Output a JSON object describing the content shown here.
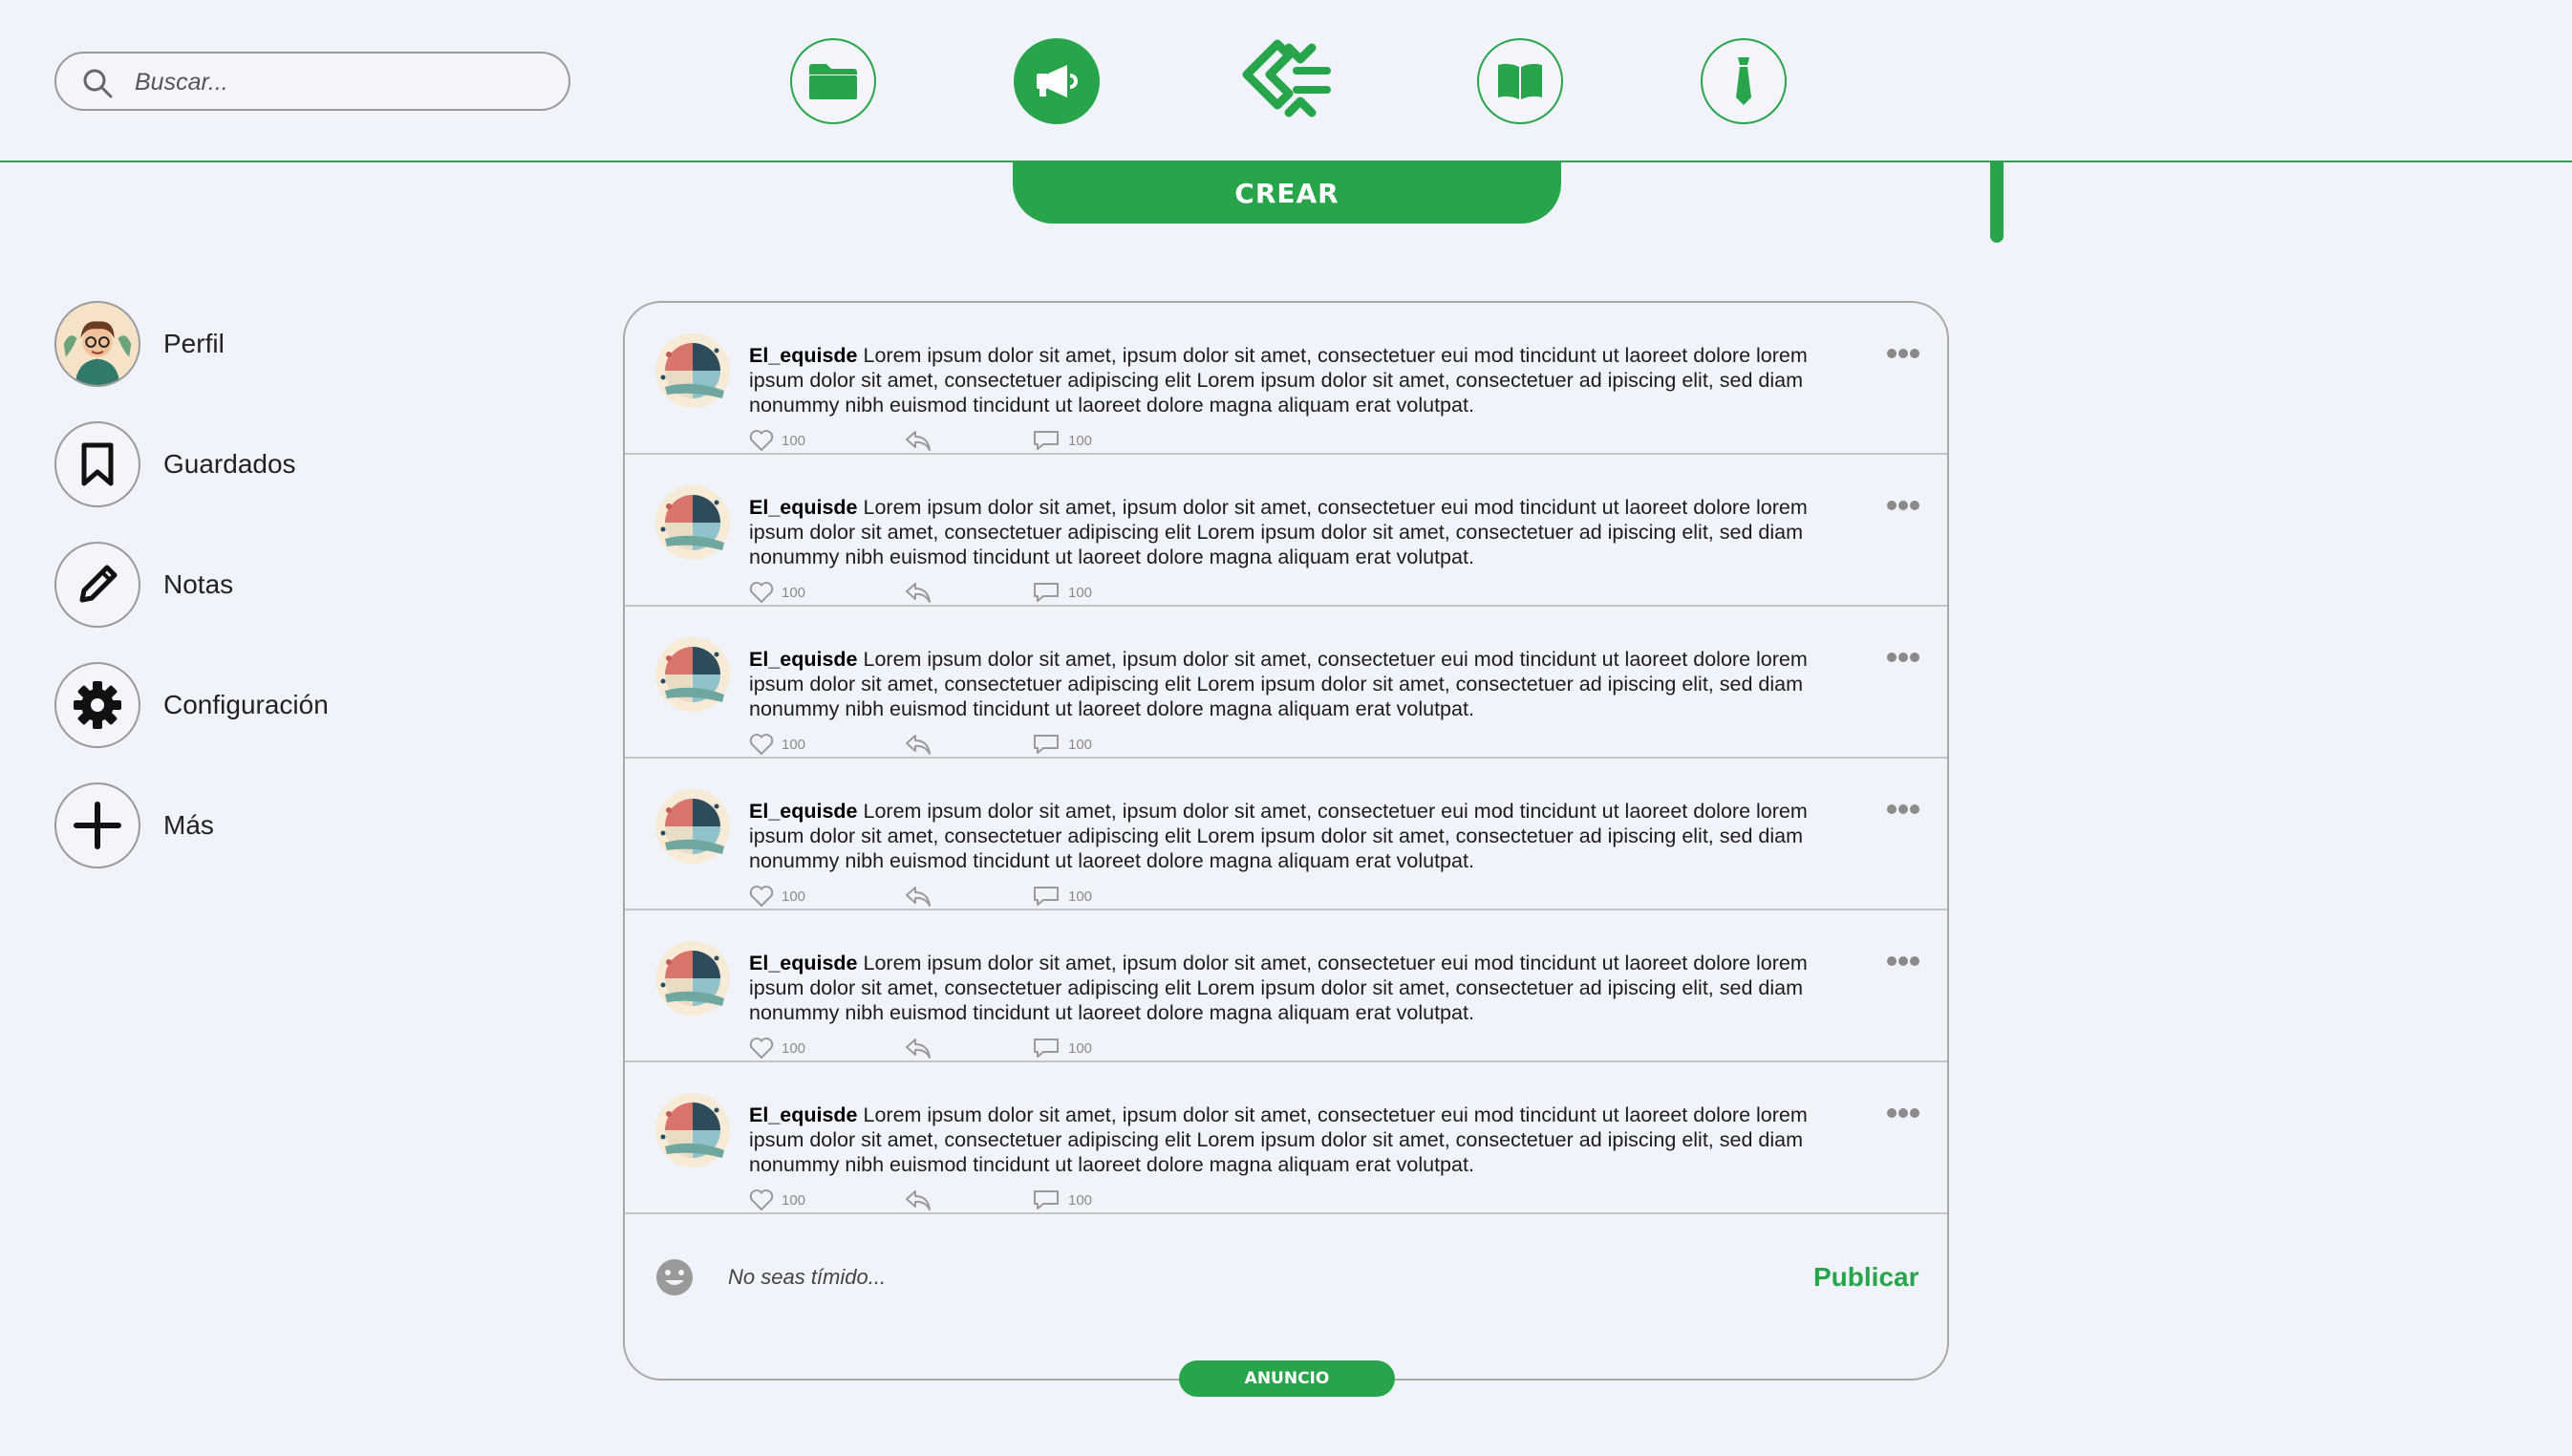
{
  "colors": {
    "accent": "#28a54b",
    "background": "#f0f3f9",
    "border": "#9a9a9a"
  },
  "header": {
    "search": {
      "placeholder": "Buscar..."
    },
    "nav": [
      {
        "name": "folder-icon"
      },
      {
        "name": "megaphone-icon",
        "active": true
      },
      {
        "name": "app-logo"
      },
      {
        "name": "book-icon"
      },
      {
        "name": "tie-icon"
      }
    ],
    "create_label": "CREAR"
  },
  "sidebar": {
    "items": [
      {
        "label": "Perfil",
        "icon": "profile-avatar"
      },
      {
        "label": "Guardados",
        "icon": "bookmark-icon"
      },
      {
        "label": "Notas",
        "icon": "pencil-icon"
      },
      {
        "label": "Configuración",
        "icon": "gear-icon"
      },
      {
        "label": "Más",
        "icon": "plus-icon"
      }
    ]
  },
  "feed": {
    "posts": [
      {
        "user": "El_equisde",
        "text": " Lorem ipsum dolor sit amet, ipsum dolor sit amet, consectetuer eui mod tincidunt ut laoreet  dolore lorem ipsum dolor sit amet, consectetuer adipiscing elit Lorem ipsum dolor sit amet, consectetuer ad ipiscing elit, sed diam nonummy nibh euismod tincidunt ut laoreet dolore magna aliquam erat volutpat.",
        "likes": "100",
        "comments": "100"
      },
      {
        "user": "El_equisde",
        "text": " Lorem ipsum dolor sit amet, ipsum dolor sit amet, consectetuer eui mod tincidunt ut laoreet  dolore lorem ipsum dolor sit amet, consectetuer adipiscing elit Lorem ipsum dolor sit amet, consectetuer ad ipiscing elit, sed diam nonummy nibh euismod tincidunt ut laoreet dolore magna aliquam erat volutpat.",
        "likes": "100",
        "comments": "100"
      },
      {
        "user": "El_equisde",
        "text": " Lorem ipsum dolor sit amet, ipsum dolor sit amet, consectetuer eui mod tincidunt ut laoreet  dolore lorem ipsum dolor sit amet, consectetuer adipiscing elit Lorem ipsum dolor sit amet, consectetuer ad ipiscing elit, sed diam nonummy nibh euismod tincidunt ut laoreet dolore magna aliquam erat volutpat.",
        "likes": "100",
        "comments": "100"
      },
      {
        "user": "El_equisde",
        "text": " Lorem ipsum dolor sit amet, ipsum dolor sit amet, consectetuer eui mod tincidunt ut laoreet  dolore lorem ipsum dolor sit amet, consectetuer adipiscing elit Lorem ipsum dolor sit amet, consectetuer ad ipiscing elit, sed diam nonummy nibh euismod tincidunt ut laoreet dolore magna aliquam erat volutpat.",
        "likes": "100",
        "comments": "100"
      },
      {
        "user": "El_equisde",
        "text": " Lorem ipsum dolor sit amet, ipsum dolor sit amet, consectetuer eui mod tincidunt ut laoreet  dolore lorem ipsum dolor sit amet, consectetuer adipiscing elit Lorem ipsum dolor sit amet, consectetuer ad ipiscing elit, sed diam nonummy nibh euismod tincidunt ut laoreet dolore magna aliquam erat volutpat.",
        "likes": "100",
        "comments": "100"
      },
      {
        "user": "El_equisde",
        "text": " Lorem ipsum dolor sit amet, ipsum dolor sit amet, consectetuer eui mod tincidunt ut laoreet  dolore lorem ipsum dolor sit amet, consectetuer adipiscing elit Lorem ipsum dolor sit amet, consectetuer ad ipiscing elit, sed diam nonummy nibh euismod tincidunt ut laoreet dolore magna aliquam erat volutpat.",
        "likes": "100",
        "comments": "100"
      }
    ],
    "composer": {
      "placeholder": "No seas tímido...",
      "publish_label": "Publicar"
    },
    "ad_label": "ANUNCIO"
  }
}
